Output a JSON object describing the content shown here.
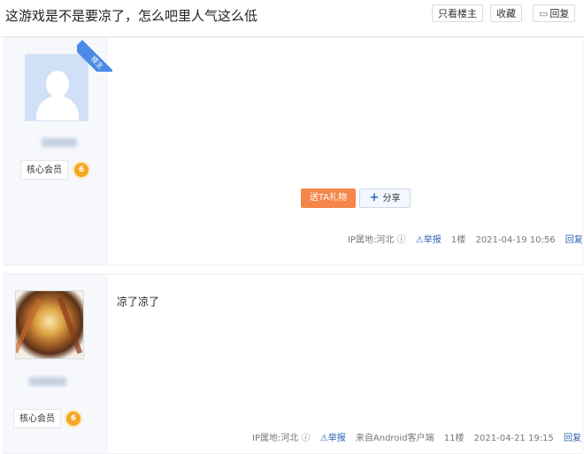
{
  "header": {
    "title": "这游戏是不是要凉了，怎么吧里人气这么低",
    "only_lz_label": "只看楼主",
    "favorite_label": "收藏",
    "reply_label": "回复"
  },
  "posts": [
    {
      "lz_tag": "楼主",
      "member_label": "核心会员",
      "level": "6",
      "gift_label": "送TA礼物",
      "share_label": "分享",
      "ip": "IP属地:河北",
      "report_label": "举报",
      "floor": "1楼",
      "time": "2021-04-19 10:56",
      "reply_label": "回复"
    },
    {
      "content": "凉了凉了",
      "member_label": "核心会员",
      "level": "6",
      "ip": "IP属地:河北",
      "report_label": "举报",
      "client": "来自Android客户端",
      "floor": "11楼",
      "time": "2021-04-21 19:15",
      "reply_label": "回复"
    }
  ],
  "icons": {
    "reply_icon": "speech-bubble",
    "info_icon": "circle-i",
    "warning_icon": "triangle-warning"
  }
}
